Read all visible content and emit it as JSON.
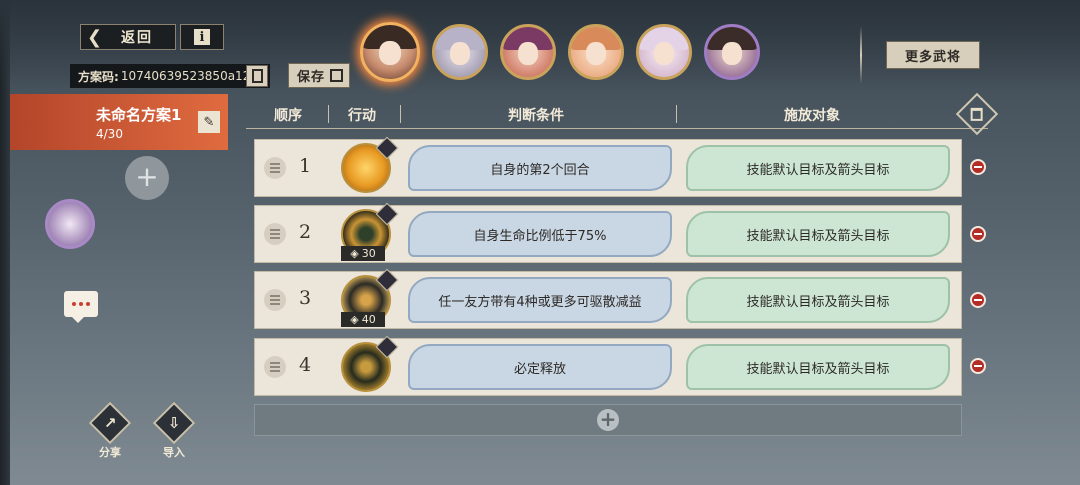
{
  "header": {
    "back_label": "返回",
    "info_label": "i",
    "code_label": "方案码:",
    "code_value": "10740639523850a12",
    "save_label": "保存",
    "more_generals_label": "更多武将"
  },
  "plan": {
    "name": "未命名方案1",
    "count": "4/30"
  },
  "table": {
    "headers": [
      "顺序",
      "行动",
      "判断条件",
      "施放对象"
    ]
  },
  "rows": [
    {
      "order": "1",
      "cooldown": "",
      "condition": "自身的第2个回合",
      "target": "技能默认目标及箭头目标"
    },
    {
      "order": "2",
      "cooldown": "30",
      "condition": "自身生命比例低于75%",
      "target": "技能默认目标及箭头目标"
    },
    {
      "order": "3",
      "cooldown": "40",
      "condition": "任一友方带有4种或更多可驱散减益",
      "target": "技能默认目标及箭头目标"
    },
    {
      "order": "4",
      "cooldown": "",
      "condition": "必定释放",
      "target": "技能默认目标及箭头目标"
    }
  ],
  "footer": {
    "share_label": "分享",
    "import_label": "导入"
  },
  "icons": {
    "back": "chevron-left-icon",
    "copy": "copy-icon",
    "save": "disk-icon",
    "edit": "pencil-icon",
    "add": "plus-icon",
    "delete_all": "trash-icon",
    "remove_row": "minus-circle-icon",
    "share": "share-icon",
    "import": "import-icon",
    "chat": "chat-icon"
  },
  "colors": {
    "accent_tab": "#e06b3f",
    "condition_fill": "#c9d6e4",
    "target_fill": "#cde6d4",
    "remove_red": "#b42c26"
  }
}
